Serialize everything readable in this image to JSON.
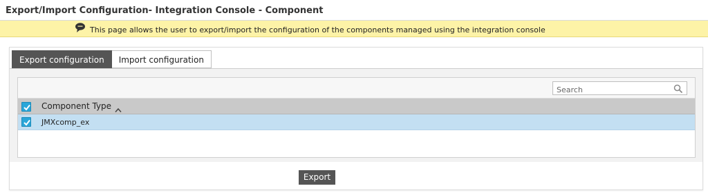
{
  "page": {
    "title": "Export/Import Configuration- Integration Console - Component",
    "info_message": "This page allows the user to export/import the configuration of the components managed using the integration console"
  },
  "tabs": [
    {
      "label": "Export configuration",
      "active": true
    },
    {
      "label": "Import configuration",
      "active": false
    }
  ],
  "grid": {
    "search_placeholder": "Search",
    "select_all_checked": true,
    "columns": [
      {
        "label": "Component Type",
        "sort": "ascending"
      }
    ],
    "rows": [
      {
        "component_type": "JMXcomp_ex",
        "checked": true,
        "selected": true
      }
    ]
  },
  "actions": {
    "export_label": "Export"
  },
  "colors": {
    "info_bar": "#fdf3a7",
    "active_tab": "#555555",
    "checkbox": "#2aa6d9",
    "selected_row": "#c3dff2",
    "header": "#c9c9c9"
  },
  "icons": {
    "info": "speech-bubble-icon",
    "search": "magnifier-icon",
    "sort": "chevron-up-icon",
    "check": "check-icon"
  }
}
